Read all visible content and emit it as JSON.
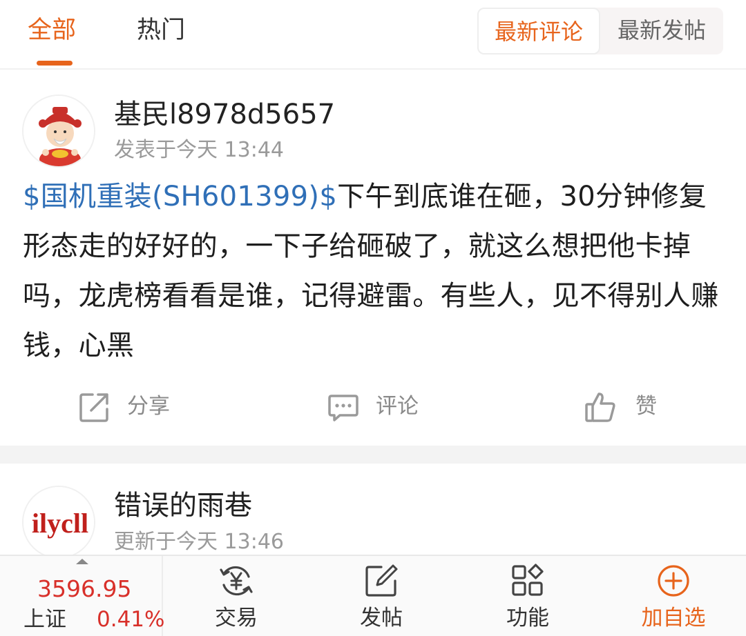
{
  "filter_tabs": [
    {
      "label": "全部",
      "active": true
    },
    {
      "label": "热门",
      "active": false
    }
  ],
  "sort_options": [
    {
      "label": "最新评论",
      "selected": true
    },
    {
      "label": "最新发帖",
      "selected": false
    }
  ],
  "posts": [
    {
      "username": "基民l8978d5657",
      "timestamp": "发表于今天 13:44",
      "stock_tag": "$国机重装(SH601399)$",
      "text": "下午到底谁在砸，30分钟修复形态走的好好的，一下子给砸破了，就这么想把他卡掉吗，龙虎榜看看是谁，记得避雷。有些人，见不得别人赚钱，心黑",
      "actions": {
        "share": "分享",
        "comment": "评论",
        "like": "赞"
      }
    },
    {
      "username": "错误的雨巷",
      "timestamp": "更新于今天 13:46",
      "avatar_text": "ilycll"
    }
  ],
  "bottom_bar": {
    "index_value": "3596.95",
    "index_name": "上证",
    "index_change": "0.41%",
    "nav": {
      "trade": "交易",
      "post": "发帖",
      "functions": "功能",
      "add_watch": "加自选"
    }
  },
  "colors": {
    "accent": "#e7641c",
    "link": "#2f6fb7",
    "up": "#d8302a",
    "muted": "#9a9a9a"
  }
}
